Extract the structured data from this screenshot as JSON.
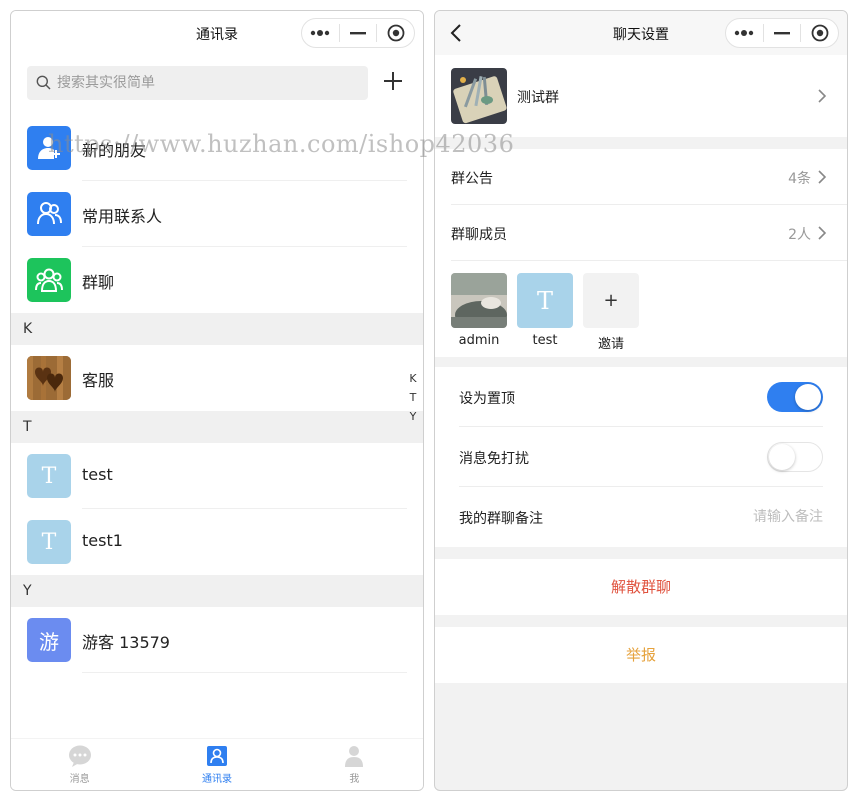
{
  "left": {
    "title": "通讯录",
    "search_placeholder": "搜索其实很简单",
    "contacts_top": [
      {
        "name": "新的朋友",
        "color": "#2f7ff0",
        "icon": "user-add-icon"
      },
      {
        "name": "常用联系人",
        "color": "#2f7ff0",
        "icon": "users-icon"
      },
      {
        "name": "群聊",
        "color": "#1dc45c",
        "icon": "group-icon"
      }
    ],
    "sections": [
      {
        "letter": "K",
        "contacts": [
          {
            "name": "客服",
            "avatar": "hearts-wood-image"
          }
        ]
      },
      {
        "letter": "T",
        "contacts": [
          {
            "name": "test",
            "avatar_text": "T"
          },
          {
            "name": "test1",
            "avatar_text": "T"
          }
        ]
      },
      {
        "letter": "Y",
        "contacts": [
          {
            "name": "游客 13579",
            "avatar_text": "游"
          }
        ]
      }
    ],
    "index_letters": [
      "K",
      "T",
      "Y"
    ],
    "tabs": [
      {
        "label": "消息",
        "icon": "chat-bubble-icon",
        "active": false
      },
      {
        "label": "通讯录",
        "icon": "contacts-icon",
        "active": true
      },
      {
        "label": "我",
        "icon": "person-icon",
        "active": false
      }
    ],
    "watermark": "https://www.huzhan.com/ishop42036"
  },
  "right": {
    "title": "聊天设置",
    "group_name": "测试群",
    "announcement_label": "群公告",
    "announcement_count": "4条",
    "members_label": "群聊成员",
    "members_count": "2人",
    "members": [
      {
        "name": "admin",
        "avatar": "photo-image"
      },
      {
        "name": "test",
        "avatar_text": "T"
      }
    ],
    "invite_label": "邀请",
    "invite_symbol": "+",
    "pin_label": "设为置顶",
    "pin_on": true,
    "mute_label": "消息免打扰",
    "mute_on": false,
    "remark_label": "我的群聊备注",
    "remark_placeholder": "请输入备注",
    "dissolve_label": "解散群聊",
    "report_label": "举报"
  },
  "colors": {
    "accent": "#2f7ff0",
    "green": "#1dc45c",
    "avatar_t": "#a9d3ea",
    "avatar_you": "#6b8cf0",
    "danger": "#e0533f",
    "warn": "#e6a23c"
  }
}
